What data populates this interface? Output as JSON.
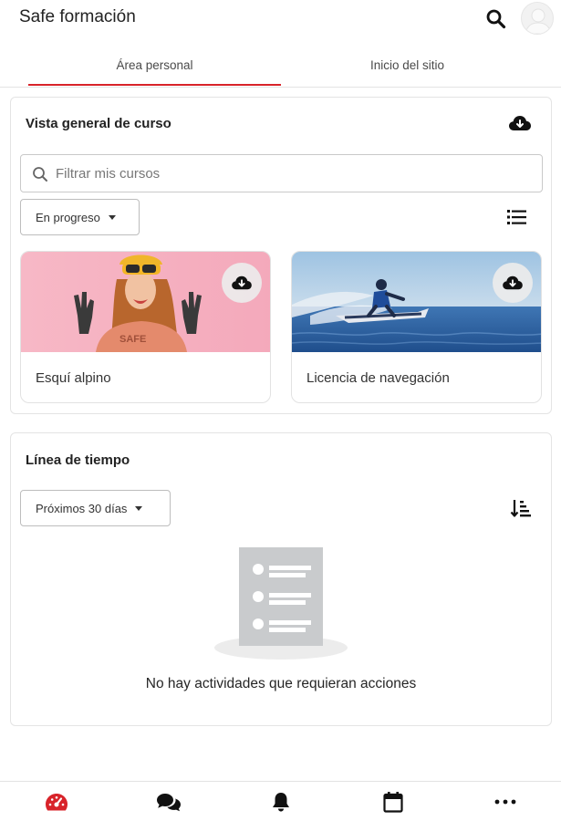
{
  "header": {
    "title": "Safe formación",
    "search_icon": "search-icon",
    "avatar_icon": "user-avatar"
  },
  "tabs": [
    {
      "label": "Área personal",
      "active": true
    },
    {
      "label": "Inicio del sitio",
      "active": false
    }
  ],
  "course_overview": {
    "title": "Vista general de curso",
    "download_icon": "cloud-download-icon",
    "search": {
      "placeholder": "Filtrar mis cursos",
      "value": ""
    },
    "filter_dropdown": {
      "selected": "En progreso"
    },
    "view_icon": "list-view-icon",
    "courses": [
      {
        "name": "Esquí alpino",
        "image": "skier-girl-pink-background",
        "download_icon": "cloud-download-icon"
      },
      {
        "name": "Licencia de navegación",
        "image": "jet-ski-on-sea",
        "download_icon": "cloud-download-icon"
      }
    ]
  },
  "timeline": {
    "title": "Línea de tiempo",
    "range_dropdown": {
      "selected": "Próximos 30 días"
    },
    "sort_icon": "sort-icon",
    "empty_icon": "empty-list-icon",
    "empty_message": "No hay actividades que requieran acciones"
  },
  "bottom_nav": [
    {
      "name": "dashboard",
      "icon": "dashboard-gauge-icon",
      "active": true
    },
    {
      "name": "messages",
      "icon": "chat-icon",
      "active": false
    },
    {
      "name": "notifications",
      "icon": "bell-icon",
      "active": false
    },
    {
      "name": "calendar",
      "icon": "calendar-icon",
      "active": false
    },
    {
      "name": "more",
      "icon": "more-icon",
      "active": false
    }
  ],
  "colors": {
    "accent": "#d8232a",
    "text": "#222222",
    "border": "#e4e4e4"
  }
}
